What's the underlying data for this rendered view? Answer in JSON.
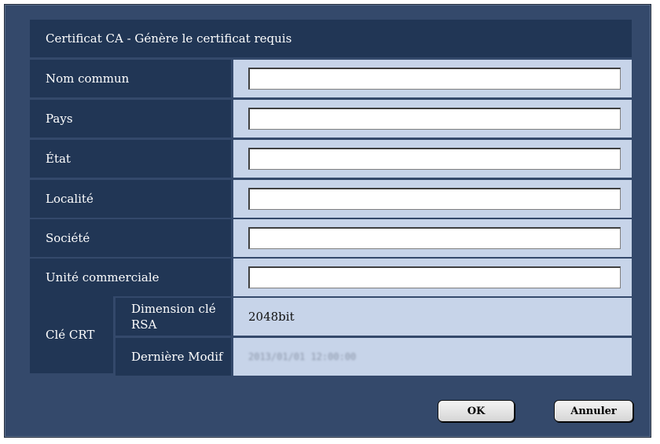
{
  "dialog": {
    "title": "Certificat CA - Génère le certificat requis"
  },
  "fields": [
    {
      "label": "Nom commun",
      "value": ""
    },
    {
      "label": "Pays",
      "value": ""
    },
    {
      "label": "État",
      "value": ""
    },
    {
      "label": "Localité",
      "value": ""
    },
    {
      "label": "Société",
      "value": ""
    },
    {
      "label": "Unité commerciale",
      "value": ""
    }
  ],
  "crt": {
    "group_label": "Clé CRT",
    "rsa_label": "Dimension clé RSA",
    "rsa_value": "2048bit",
    "modif_label": "Dernière Modif",
    "modif_value": "2013/01/01 12:00:00"
  },
  "buttons": {
    "ok": "OK",
    "cancel": "Annuler"
  },
  "colors": {
    "dialog_bg": "#34496b",
    "label_bg": "#213655",
    "value_bg": "#c7d4e9"
  }
}
